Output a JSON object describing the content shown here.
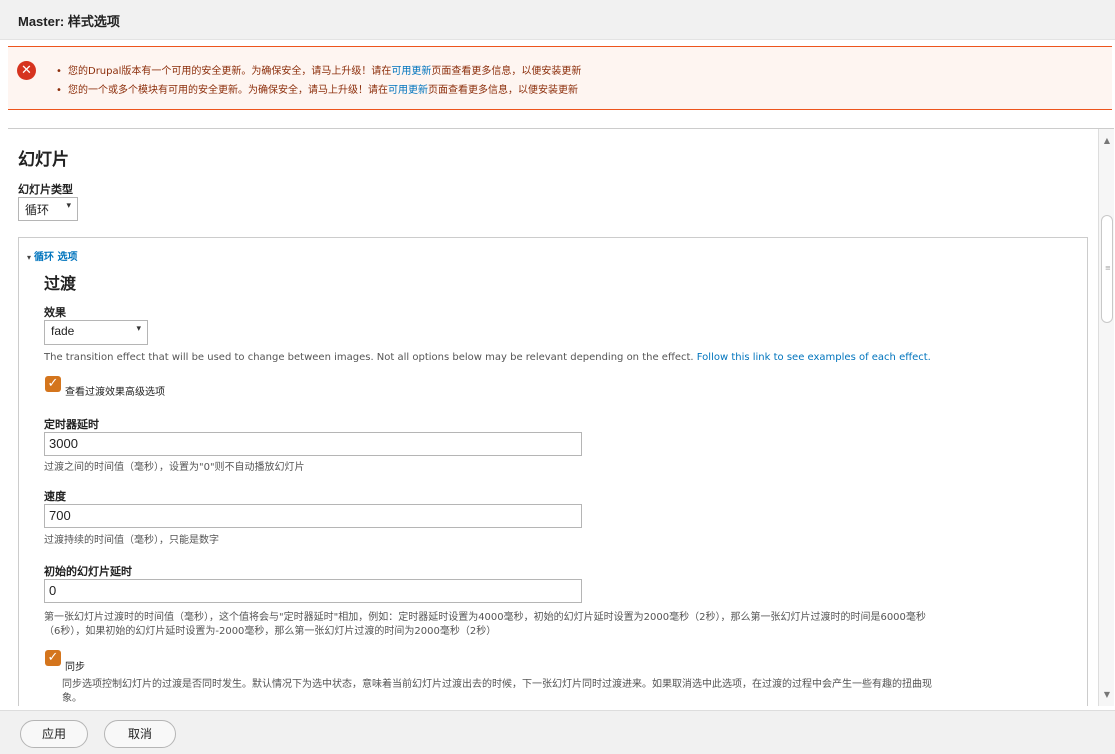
{
  "header": {
    "title": "Master: 样式选项"
  },
  "messages": {
    "items": [
      {
        "before": "您的Drupal版本有一个可用的安全更新。为确保安全，请马上升级！请在",
        "link": "可用更新",
        "after": "页面查看更多信息，以便安装更新"
      },
      {
        "before": "您的一个或多个模块有可用的安全更新。为确保安全，请马上升级！请在",
        "link": "可用更新",
        "after": "页面查看更多信息，以便安装更新"
      }
    ]
  },
  "slideshow": {
    "heading": "幻灯片",
    "type_label": "幻灯片类型",
    "type_value": "循环"
  },
  "cycle": {
    "legend": "循环 选项",
    "transition_heading": "过渡",
    "effect_label": "效果",
    "effect_value": "fade",
    "effect_desc": "The transition effect that will be used to change between images. Not all options below may be relevant depending on the effect.",
    "effect_link": "Follow this link to see examples of each effect.",
    "advanced_label": "查看过渡效果高级选项",
    "advanced_checked": true,
    "timeout_label": "定时器延时",
    "timeout_value": "3000",
    "timeout_desc": "过渡之间的时间值（毫秒），设置为\"0\"则不自动播放幻灯片",
    "speed_label": "速度",
    "speed_value": "700",
    "speed_desc": "过渡持续的时间值（毫秒），只能是数字",
    "delay_label": "初始的幻灯片延时",
    "delay_value": "0",
    "delay_desc_1": "第一张幻灯片过渡时的时间值（毫秒），这个值将会与\"定时器延时\"相加，例如：定时器延时设置为4000毫秒，初始的幻灯片延时设置为2000毫秒（2秒），那么第一张幻灯片过渡时的时间是6000毫秒",
    "delay_desc_2": "（6秒），如果初始的幻灯片延时设置为-2000毫秒，那么第一张幻灯片过渡的时间为2000毫秒（2秒）",
    "sync_label": "同步",
    "sync_checked": true,
    "sync_desc_1": "同步选项控制幻灯片的过渡是否同时发生。默认情况下为选中状态，意味着当前幻灯片过渡出去的时候，下一张幻灯片同时过渡进来。如果取消选中此选项，在过渡的过程中会产生一些有趣的扭曲现",
    "sync_desc_2": "象。"
  },
  "footer": {
    "apply": "应用",
    "cancel": "取消"
  },
  "colors": {
    "accent": "#0074bd",
    "error": "#ed541d",
    "checkbox": "#d4751d"
  }
}
